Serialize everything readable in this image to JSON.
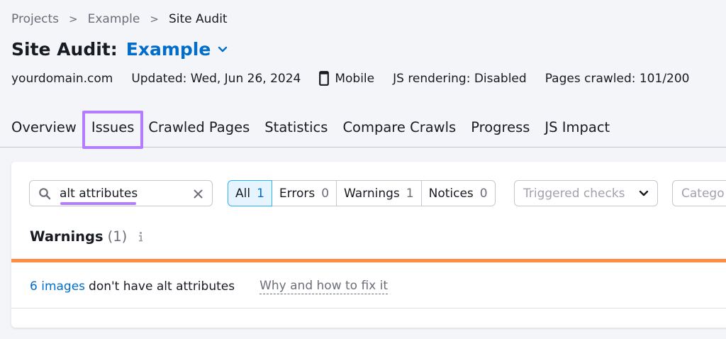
{
  "breadcrumb": {
    "items": [
      "Projects",
      "Example",
      "Site Audit"
    ]
  },
  "header": {
    "title": "Site Audit:",
    "project": "Example"
  },
  "meta": {
    "domain": "yourdomain.com",
    "updated": "Updated: Wed, Jun 26, 2024",
    "device": "Mobile",
    "js_rendering": "JS rendering: Disabled",
    "pages_crawled": "Pages crawled: 101/200"
  },
  "tabs": [
    {
      "label": "Overview"
    },
    {
      "label": "Issues",
      "active": true
    },
    {
      "label": "Crawled Pages"
    },
    {
      "label": "Statistics"
    },
    {
      "label": "Compare Crawls"
    },
    {
      "label": "Progress"
    },
    {
      "label": "JS Impact"
    }
  ],
  "search": {
    "value": "alt attributes"
  },
  "filters": [
    {
      "label": "All",
      "count": "1",
      "active": true
    },
    {
      "label": "Errors",
      "count": "0"
    },
    {
      "label": "Warnings",
      "count": "1"
    },
    {
      "label": "Notices",
      "count": "0"
    }
  ],
  "triggered_checks": {
    "placeholder": "Triggered checks"
  },
  "category": {
    "placeholder": "Catego"
  },
  "section": {
    "label": "Warnings",
    "count": "(1)"
  },
  "issue": {
    "link": "6 images",
    "text": "don't have alt attributes",
    "fix": "Why and how to fix it"
  },
  "colors": {
    "accent": "#006dca",
    "highlight": "#b47dff",
    "warning_bar": "#ff8c43",
    "active_filter_bg": "#e6f4ff"
  }
}
